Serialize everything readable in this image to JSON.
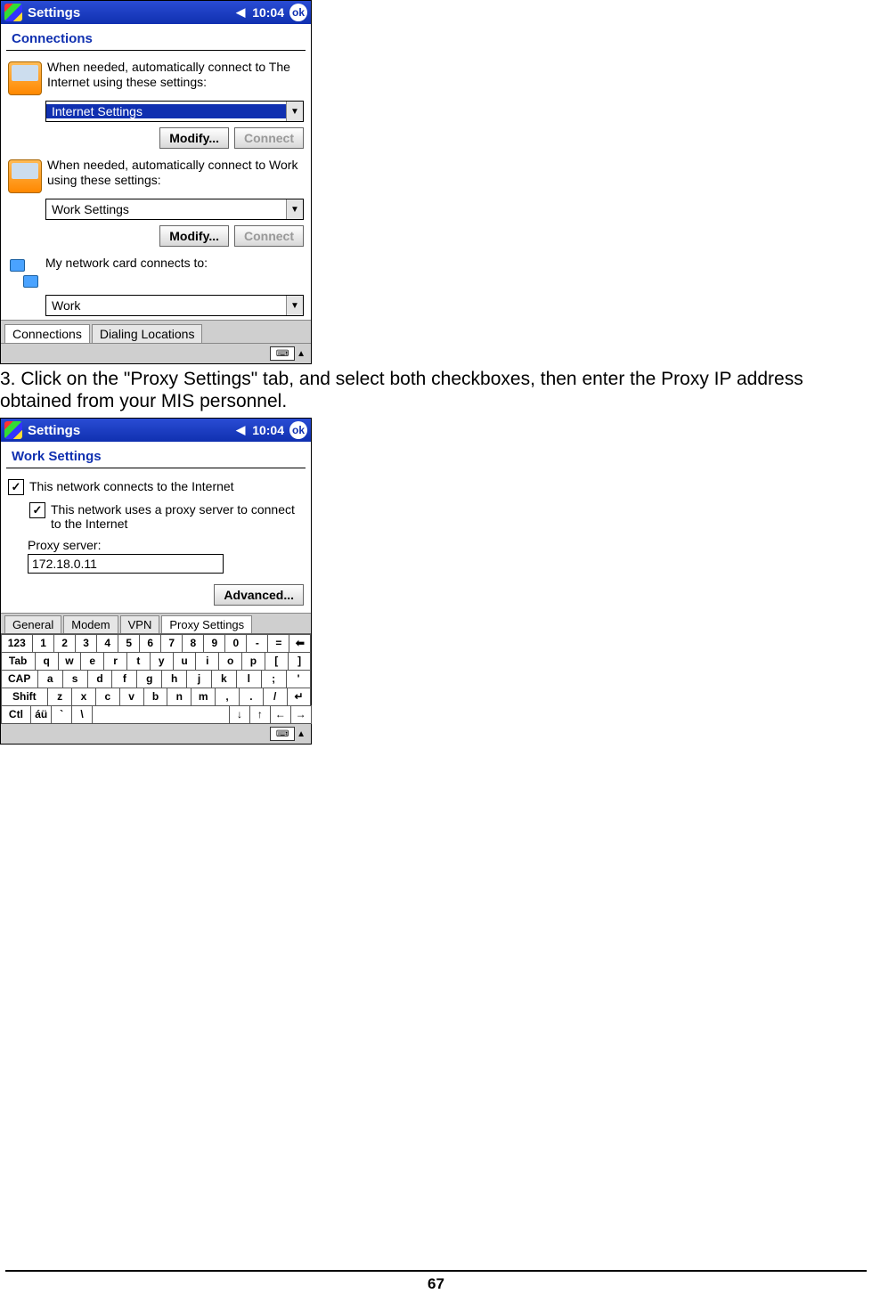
{
  "device1": {
    "titlebar": {
      "title": "Settings",
      "time": "10:04",
      "ok": "ok"
    },
    "section_title": "Connections",
    "internet_text": "When needed, automatically connect to The Internet using these settings:",
    "internet_combo": "Internet Settings",
    "work_text": "When needed, automatically connect to Work using these settings:",
    "work_combo": "Work Settings",
    "card_text": "My network card connects to:",
    "card_combo": "Work",
    "modify": "Modify...",
    "connect": "Connect",
    "tabs": {
      "connections": "Connections",
      "dialing": "Dialing Locations"
    }
  },
  "instruction": "3. Click on the \"Proxy Settings\" tab, and select both checkboxes, then enter the Proxy IP address obtained from your MIS personnel.",
  "device2": {
    "titlebar": {
      "title": "Settings",
      "time": "10:04",
      "ok": "ok"
    },
    "section_title": "Work Settings",
    "chk1": "This network connects to the Internet",
    "chk2": "This network uses a proxy server to connect to the Internet",
    "proxy_label": "Proxy server:",
    "proxy_value": "172.18.0.11",
    "advanced": "Advanced...",
    "tabs": {
      "general": "General",
      "modem": "Modem",
      "vpn": "VPN",
      "proxy": "Proxy Settings"
    },
    "osk": {
      "r1": [
        "123",
        "1",
        "2",
        "3",
        "4",
        "5",
        "6",
        "7",
        "8",
        "9",
        "0",
        "-",
        "=",
        "⬅"
      ],
      "r2": [
        "Tab",
        "q",
        "w",
        "e",
        "r",
        "t",
        "y",
        "u",
        "i",
        "o",
        "p",
        "[",
        "]"
      ],
      "r3": [
        "CAP",
        "a",
        "s",
        "d",
        "f",
        "g",
        "h",
        "j",
        "k",
        "l",
        ";",
        "'"
      ],
      "r4": [
        "Shift",
        "z",
        "x",
        "c",
        "v",
        "b",
        "n",
        "m",
        ",",
        ".",
        "/",
        "↵"
      ],
      "r5": [
        "Ctl",
        "áü",
        "`",
        "\\",
        "",
        "↓",
        "↑",
        "←",
        "→"
      ]
    }
  },
  "page_number": "67"
}
